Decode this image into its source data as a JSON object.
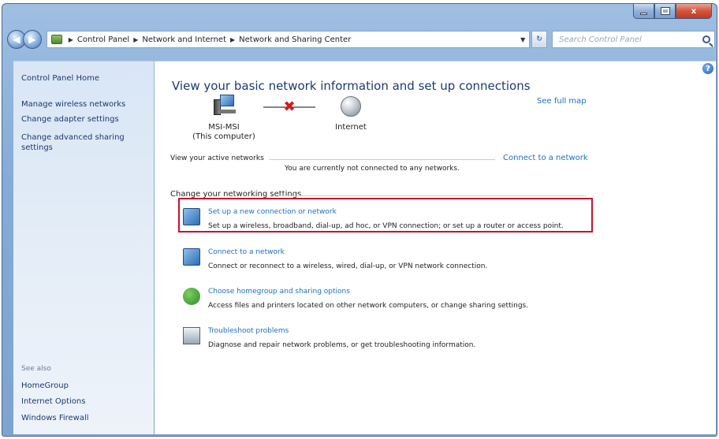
{
  "window": {
    "title_buttons": {
      "minimize": "",
      "maximize": "",
      "close": "x"
    }
  },
  "address_bar": {
    "breadcrumbs": [
      "Control Panel",
      "Network and Internet",
      "Network and Sharing Center"
    ],
    "search_placeholder": "Search Control Panel"
  },
  "sidebar": {
    "home": "Control Panel Home",
    "links": [
      "Manage wireless networks",
      "Change adapter settings",
      "Change advanced sharing settings"
    ],
    "see_also_label": "See also",
    "see_also": [
      "HomeGroup",
      "Internet Options",
      "Windows Firewall"
    ]
  },
  "main": {
    "title": "View your basic network information and set up connections",
    "see_full_map": "See full map",
    "map": {
      "computer_name": "MSI-MSI",
      "computer_sub": "(This computer)",
      "internet": "Internet"
    },
    "active_networks_label": "View your active networks",
    "connect_to_network": "Connect to a network",
    "not_connected_text": "You are currently not connected to any networks.",
    "change_settings_label": "Change your networking settings",
    "tasks": [
      {
        "title": "Set up a new connection or network",
        "desc": "Set up a wireless, broadband, dial-up, ad hoc, or VPN connection; or set up a router or access point.",
        "icon": "network-setup-icon",
        "highlighted": true
      },
      {
        "title": "Connect to a network",
        "desc": "Connect or reconnect to a wireless, wired, dial-up, or VPN network connection.",
        "icon": "connect-network-icon"
      },
      {
        "title": "Choose homegroup and sharing options",
        "desc": "Access files and printers located on other network computers, or change sharing settings.",
        "icon": "homegroup-icon"
      },
      {
        "title": "Troubleshoot problems",
        "desc": "Diagnose and repair network problems, or get troubleshooting information.",
        "icon": "troubleshoot-icon"
      }
    ]
  },
  "colors": {
    "link": "#1f6fbf",
    "title": "#1e3a70",
    "highlight_border": "#c8122b",
    "disconnect_x": "#d11b1b"
  }
}
